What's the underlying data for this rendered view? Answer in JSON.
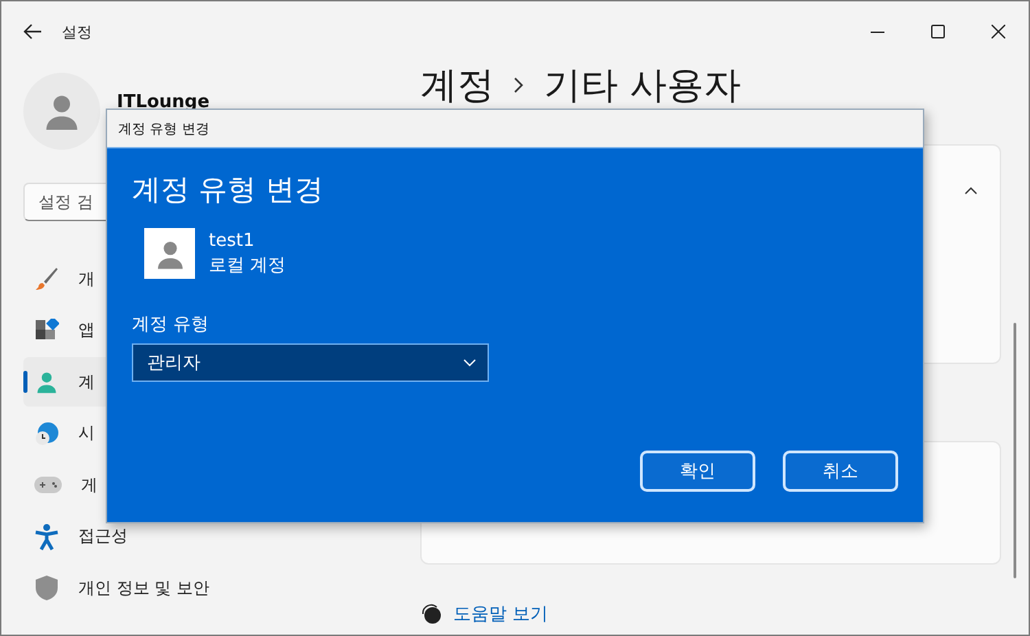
{
  "window": {
    "title": "설정"
  },
  "account": {
    "name": "ITLounge"
  },
  "search": {
    "placeholder": "설정 검"
  },
  "sidebar": {
    "items": [
      {
        "label": "개",
        "kind": "brush",
        "selected": false
      },
      {
        "label": "앱",
        "kind": "apps",
        "selected": false
      },
      {
        "label": "계",
        "kind": "person",
        "selected": true
      },
      {
        "label": "시",
        "kind": "globe",
        "selected": false
      },
      {
        "label": "게",
        "kind": "gamepad",
        "selected": false
      },
      {
        "label": "접근성",
        "kind": "accessibility",
        "selected": false
      },
      {
        "label": "개인 정보 및 보안",
        "kind": "shield",
        "selected": false
      }
    ]
  },
  "breadcrumb": [
    "계정",
    "기타 사용자"
  ],
  "help_link": "도움말 보기",
  "dialog": {
    "title": "계정 유형 변경",
    "heading": "계정 유형 변경",
    "user": {
      "name": "test1",
      "type": "로컬 계정"
    },
    "field_label": "계정 유형",
    "value": "관리자",
    "buttons": [
      "확인",
      "취소"
    ]
  }
}
